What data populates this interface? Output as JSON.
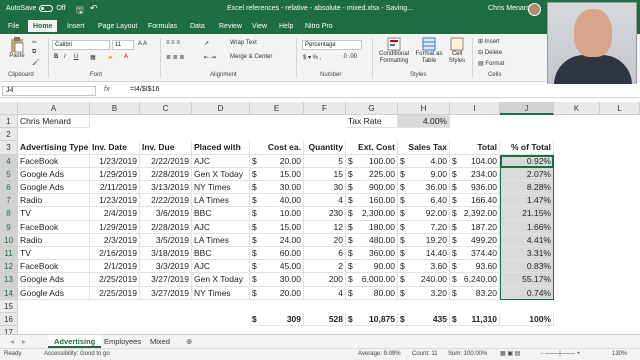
{
  "titlebar": {
    "autosave_label": "AutoSave",
    "autosave_state": "Off",
    "title": "Excel references - relative - absolute - mixed.xlsx - Saving...",
    "user": "Chris Menard",
    "window_controls": [
      "minimize",
      "restore",
      "close"
    ]
  },
  "tabs": [
    "File",
    "Home",
    "Insert",
    "Page Layout",
    "Formulas",
    "Data",
    "Review",
    "View",
    "Help",
    "Nitro Pro"
  ],
  "active_tab": "Home",
  "ribbon": {
    "clipboard": {
      "paste": "Paste",
      "label": "Clipboard"
    },
    "font": {
      "name": "Calibri",
      "size": "11",
      "label": "Font"
    },
    "alignment": {
      "wrap": "Wrap Text",
      "merge": "Merge & Center",
      "label": "Alignment"
    },
    "number": {
      "format": "Percentage",
      "label": "Number"
    },
    "styles": {
      "conditional": "Conditional Formatting",
      "table": "Format as Table",
      "cell": "Cell Styles",
      "label": "Styles"
    },
    "cells": {
      "insert": "Insert",
      "delete": "Delete",
      "format": "Format",
      "label": "Cells"
    }
  },
  "formula_bar": {
    "name_box": "J4",
    "fx": "fx",
    "formula": "=I4/$I$16"
  },
  "columns": [
    "A",
    "B",
    "C",
    "D",
    "E",
    "F",
    "G",
    "H",
    "I",
    "J",
    "K",
    "L"
  ],
  "sheet": {
    "r1": {
      "a": "Chris Menard",
      "g": "Tax Rate",
      "h": "4.00%"
    },
    "headers": [
      "Advertising Type",
      "Inv. Date",
      "Inv. Due",
      "Placed with",
      "Cost ea.",
      "Quantity",
      "Ext. Cost",
      "Sales Tax",
      "Total",
      "% of Total"
    ],
    "rows": [
      [
        "FaceBook",
        "1/23/2019",
        "2/22/2019",
        "AJC",
        "20.00",
        "5",
        "100.00",
        "4.00",
        "104.00",
        "0.92%"
      ],
      [
        "Google Ads",
        "1/29/2019",
        "2/28/2019",
        "Gen X Today",
        "15.00",
        "15",
        "225.00",
        "9.00",
        "234.00",
        "2.07%"
      ],
      [
        "Google Ads",
        "2/11/2019",
        "3/13/2019",
        "NY Times",
        "30.00",
        "30",
        "900.00",
        "36.00",
        "936.00",
        "8.28%"
      ],
      [
        "Radio",
        "1/23/2019",
        "2/22/2019",
        "LA Times",
        "40.00",
        "4",
        "160.00",
        "6.40",
        "166.40",
        "1.47%"
      ],
      [
        "TV",
        "2/4/2019",
        "3/6/2019",
        "BBC",
        "10.00",
        "230",
        "2,300.00",
        "92.00",
        "2,392.00",
        "21.15%"
      ],
      [
        "FaceBook",
        "1/29/2019",
        "2/28/2019",
        "AJC",
        "15.00",
        "12",
        "180.00",
        "7.20",
        "187.20",
        "1.66%"
      ],
      [
        "Radio",
        "2/3/2019",
        "3/5/2019",
        "LA Times",
        "24.00",
        "20",
        "480.00",
        "19.20",
        "499.20",
        "4.41%"
      ],
      [
        "TV",
        "2/16/2019",
        "3/18/2019",
        "BBC",
        "60.00",
        "6",
        "360.00",
        "14.40",
        "374.40",
        "3.31%"
      ],
      [
        "FaceBook",
        "2/1/2019",
        "3/3/2019",
        "AJC",
        "45.00",
        "2",
        "90.00",
        "3.60",
        "93.60",
        "0.83%"
      ],
      [
        "Google Ads",
        "2/25/2019",
        "3/27/2019",
        "Gen X Today",
        "30.00",
        "200",
        "6,000.00",
        "240.00",
        "6,240.00",
        "55.17%"
      ],
      [
        "Google Ads",
        "2/25/2019",
        "3/27/2019",
        "NY Times",
        "20.00",
        "4",
        "80.00",
        "3.20",
        "83.20",
        "0.74%"
      ]
    ],
    "totals": {
      "cost": "309",
      "qty": "528",
      "ext": "10,875",
      "tax": "435",
      "total": "11,310",
      "pct": "100%"
    },
    "currency_symbol": "$"
  },
  "sheet_tabs": [
    "Advertising",
    "Employees",
    "Mixed"
  ],
  "active_sheet": "Advertising",
  "status": {
    "ready": "Ready",
    "accessibility": "Accessibility: Good to go",
    "average": "Average: 9.09%",
    "count": "Count: 11",
    "sum": "Sum: 100.00%",
    "zoom": "130%"
  },
  "colors": {
    "accent": "#1e6c41",
    "selection": "#d9d9d9"
  }
}
